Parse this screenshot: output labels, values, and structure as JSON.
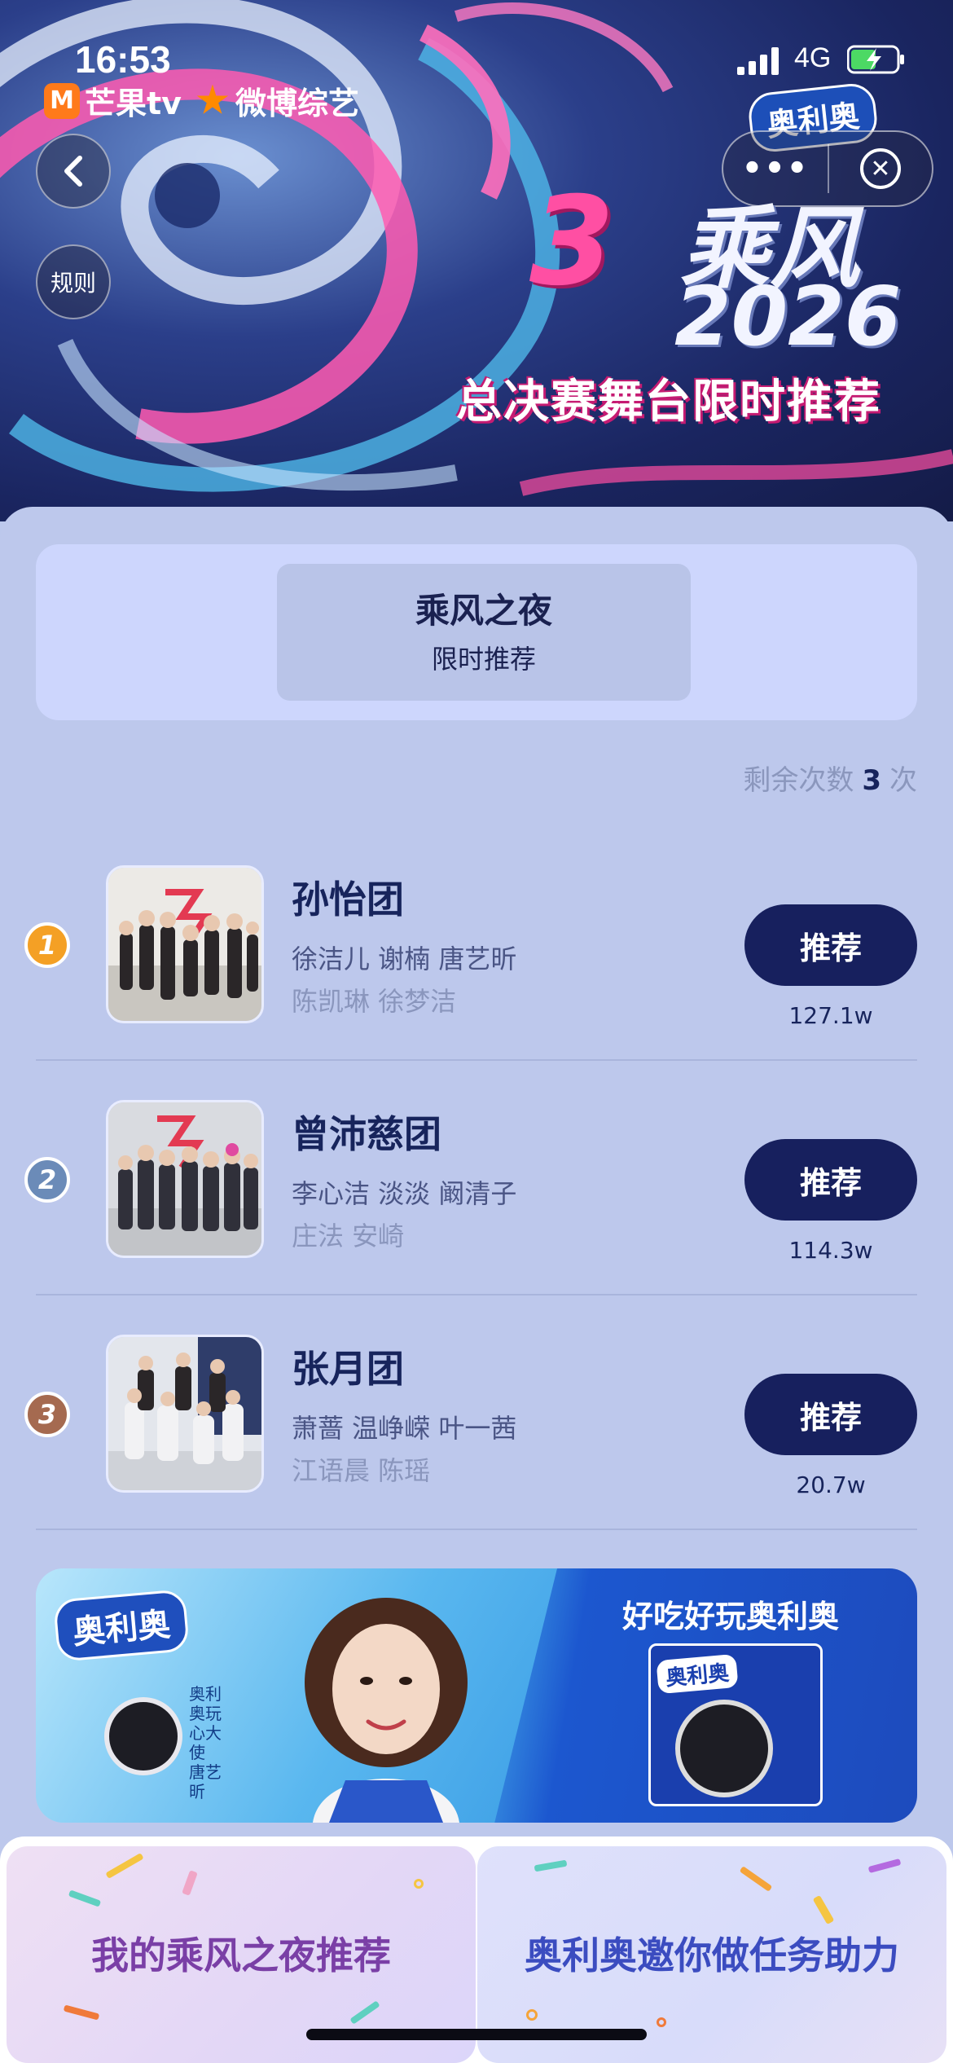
{
  "status_bar": {
    "time": "16:53",
    "network": "4G"
  },
  "header": {
    "logos": {
      "mango": "芒果tv",
      "weibo": "微博综艺"
    },
    "brand_badge": "奥利奥",
    "rule_label": "规则",
    "more_label": "•••",
    "title_mark": "3",
    "title_main": "乘风",
    "title_year": "2026",
    "subtitle": "总决赛舞台限时推荐"
  },
  "tab": {
    "title": "乘风之夜",
    "subtitle": "限时推荐"
  },
  "remaining": {
    "label": "剩余次数",
    "count": "3",
    "unit": "次"
  },
  "colors": {
    "rank1": "#f4a025",
    "rank2": "#6b8bb8",
    "rank3": "#a56a50",
    "button": "#17205e"
  },
  "teams": [
    {
      "rank": "1",
      "name": "孙怡团",
      "members_line1": "徐洁儿 谢楠 唐艺昕",
      "members_line2": "陈凯琳 徐梦洁",
      "button": "推荐",
      "votes": "127.1w"
    },
    {
      "rank": "2",
      "name": "曾沛慈团",
      "members_line1": "李心洁 淡淡 阚清子",
      "members_line2": "庄法 安崎",
      "button": "推荐",
      "votes": "114.3w"
    },
    {
      "rank": "3",
      "name": "张月团",
      "members_line1": "萧蔷 温峥嵘 叶一茜",
      "members_line2": "江语晨 陈瑶",
      "button": "推荐",
      "votes": "20.7w"
    }
  ],
  "ad": {
    "logo": "奥利奥",
    "ambassador": "奥利奥玩心大使 唐艺昕",
    "slogan": "好吃好玩奥利奥",
    "box_logo": "奥利奥"
  },
  "bottom": {
    "left_label": "我的乘风之夜推荐",
    "right_label": "奥利奥邀你做任务助力"
  }
}
